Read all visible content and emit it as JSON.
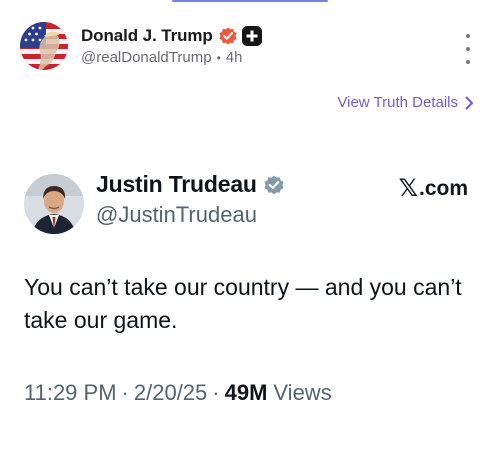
{
  "post": {
    "author_name": "Donald J. Trump",
    "author_handle": "@realDonaldTrump",
    "time_ago": "4h",
    "view_details_label": "View Truth Details"
  },
  "embedded_tweet": {
    "display_name": "Justin Trudeau",
    "handle": "@JustinTrudeau",
    "source_label": ".com",
    "text": "You can’t take our country — and you can’t take our game.",
    "time": "11:29 PM",
    "date": "2/20/25",
    "views_count": "49M",
    "views_label": "Views"
  },
  "colors": {
    "accent_link": "#6a5fd6",
    "verified_orange": "#ec5a3a",
    "verified_gray": "#829aab",
    "muted_text": "#536471"
  },
  "icons": [
    "american-flag-avatar-icon",
    "verified-badge-icon",
    "plus-badge-icon",
    "more-options-icon",
    "chevron-right-icon",
    "x-logo-icon"
  ]
}
